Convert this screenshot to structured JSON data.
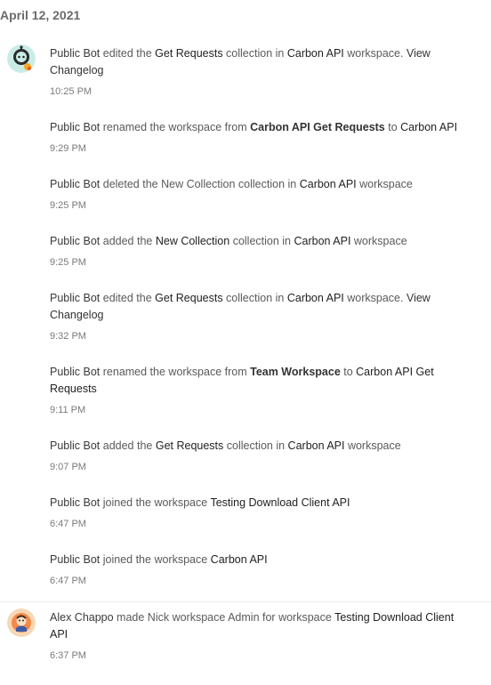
{
  "date_header": "April 12, 2021",
  "entries": [
    {
      "segments": [
        {
          "t": "Public Bot",
          "k": "actor"
        },
        {
          "t": " edited the ",
          "k": "text"
        },
        {
          "t": "Get Requests",
          "k": "obj"
        },
        {
          "t": " collection in ",
          "k": "text"
        },
        {
          "t": "Carbon API",
          "k": "obj"
        },
        {
          "t": " workspace. ",
          "k": "text"
        },
        {
          "t": "View Changelog",
          "k": "link"
        }
      ],
      "time": "10:25 PM",
      "avatar": "bot-avatar"
    },
    {
      "segments": [
        {
          "t": "Public Bot",
          "k": "actor"
        },
        {
          "t": " renamed the workspace from ",
          "k": "text"
        },
        {
          "t": "Carbon API Get Requests",
          "k": "bold"
        },
        {
          "t": " to ",
          "k": "text"
        },
        {
          "t": "Carbon API",
          "k": "obj"
        }
      ],
      "time": "9:29 PM"
    },
    {
      "segments": [
        {
          "t": "Public Bot",
          "k": "actor"
        },
        {
          "t": " deleted the New Collection collection in ",
          "k": "text"
        },
        {
          "t": "Carbon API",
          "k": "obj"
        },
        {
          "t": " workspace",
          "k": "text"
        }
      ],
      "time": "9:25 PM"
    },
    {
      "segments": [
        {
          "t": "Public Bot",
          "k": "actor"
        },
        {
          "t": " added the ",
          "k": "text"
        },
        {
          "t": "New Collection",
          "k": "obj"
        },
        {
          "t": " collection in ",
          "k": "text"
        },
        {
          "t": "Carbon API",
          "k": "obj"
        },
        {
          "t": " workspace",
          "k": "text"
        }
      ],
      "time": "9:25 PM"
    },
    {
      "segments": [
        {
          "t": "Public Bot",
          "k": "actor"
        },
        {
          "t": " edited the ",
          "k": "text"
        },
        {
          "t": "Get Requests",
          "k": "obj"
        },
        {
          "t": " collection in ",
          "k": "text"
        },
        {
          "t": "Carbon API",
          "k": "obj"
        },
        {
          "t": " workspace. ",
          "k": "text"
        },
        {
          "t": "View Changelog",
          "k": "link"
        }
      ],
      "time": "9:32 PM"
    },
    {
      "segments": [
        {
          "t": "Public Bot",
          "k": "actor"
        },
        {
          "t": " renamed the workspace from ",
          "k": "text"
        },
        {
          "t": "Team Workspace",
          "k": "bold"
        },
        {
          "t": " to ",
          "k": "text"
        },
        {
          "t": "Carbon API Get Requests",
          "k": "obj"
        }
      ],
      "time": "9:11 PM"
    },
    {
      "segments": [
        {
          "t": "Public Bot",
          "k": "actor"
        },
        {
          "t": " added the ",
          "k": "text"
        },
        {
          "t": "Get Requests",
          "k": "obj"
        },
        {
          "t": " collection in ",
          "k": "text"
        },
        {
          "t": "Carbon API",
          "k": "obj"
        },
        {
          "t": " workspace",
          "k": "text"
        }
      ],
      "time": "9:07 PM"
    },
    {
      "segments": [
        {
          "t": "Public Bot",
          "k": "actor"
        },
        {
          "t": " joined the workspace ",
          "k": "text"
        },
        {
          "t": "Testing Download Client API",
          "k": "obj"
        }
      ],
      "time": "6:47 PM"
    },
    {
      "segments": [
        {
          "t": "Public Bot",
          "k": "actor"
        },
        {
          "t": " joined the workspace ",
          "k": "text"
        },
        {
          "t": "Carbon API",
          "k": "obj"
        }
      ],
      "time": "6:47 PM"
    },
    {
      "segments": [
        {
          "t": "Alex Chappo",
          "k": "actor"
        },
        {
          "t": " made Nick workspace Admin for workspace ",
          "k": "text"
        },
        {
          "t": "Testing Download Client API",
          "k": "obj"
        }
      ],
      "time": "6:37 PM",
      "avatar": "user-avatar"
    }
  ]
}
